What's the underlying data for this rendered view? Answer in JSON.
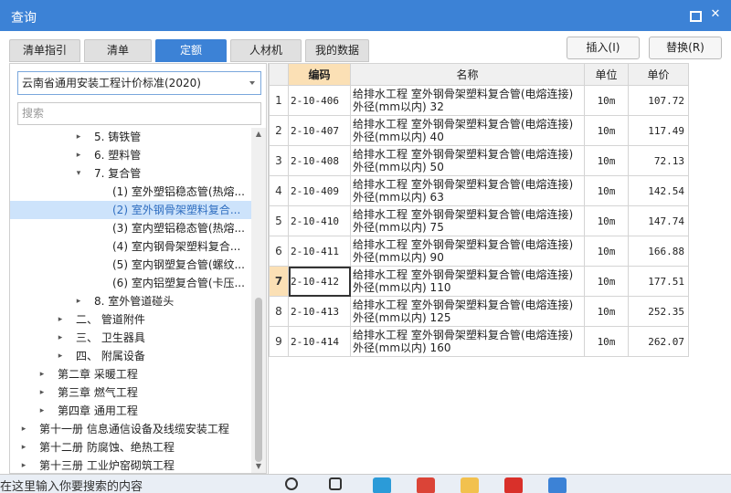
{
  "window": {
    "title": "查询"
  },
  "tabs": [
    "清单指引",
    "清单",
    "定额",
    "人材机",
    "我的数据"
  ],
  "active_tab": 2,
  "actions": {
    "insert": "插入(I)",
    "replace": "替换(R)"
  },
  "standard_select": {
    "value": "云南省通用安装工程计价标准(2020)"
  },
  "search": {
    "placeholder": "搜索"
  },
  "tree": [
    {
      "label": "5. 铸铁管",
      "arrow": "▸",
      "indent": 4
    },
    {
      "label": "6. 塑料管",
      "arrow": "▸",
      "indent": 4
    },
    {
      "label": "7. 复合管",
      "arrow": "▾",
      "indent": 4
    },
    {
      "label": "(1) 室外塑铝稳态管(热熔...",
      "arrow": "",
      "indent": 5
    },
    {
      "label": "(2) 室外钢骨架塑料复合...",
      "arrow": "",
      "indent": 5,
      "selected": true
    },
    {
      "label": "(3) 室内塑铝稳态管(热熔...",
      "arrow": "",
      "indent": 5
    },
    {
      "label": "(4) 室内钢骨架塑料复合...",
      "arrow": "",
      "indent": 5
    },
    {
      "label": "(5) 室内钢塑复合管(螺纹...",
      "arrow": "",
      "indent": 5
    },
    {
      "label": "(6) 室内铝塑复合管(卡压...",
      "arrow": "",
      "indent": 5
    },
    {
      "label": "8. 室外管道碰头",
      "arrow": "▸",
      "indent": 4
    },
    {
      "label": "二、 管道附件",
      "arrow": "▸",
      "indent": 3
    },
    {
      "label": "三、 卫生器具",
      "arrow": "▸",
      "indent": 3
    },
    {
      "label": "四、 附属设备",
      "arrow": "▸",
      "indent": 3
    },
    {
      "label": "第二章 采暖工程",
      "arrow": "▸",
      "indent": 2
    },
    {
      "label": "第三章 燃气工程",
      "arrow": "▸",
      "indent": 2
    },
    {
      "label": "第四章 通用工程",
      "arrow": "▸",
      "indent": 2
    },
    {
      "label": "第十一册 信息通信设备及线缆安装工程",
      "arrow": "▸",
      "indent": 1
    },
    {
      "label": "第十二册 防腐蚀、绝热工程",
      "arrow": "▸",
      "indent": 1
    },
    {
      "label": "第十三册 工业炉窑砌筑工程",
      "arrow": "▸",
      "indent": 1
    }
  ],
  "grid": {
    "headers": {
      "code": "编码",
      "name": "名称",
      "unit": "单位",
      "price": "单价"
    },
    "current_row": 7,
    "rows": [
      {
        "num": "1",
        "code": "2-10-406",
        "name": "给排水工程 室外钢骨架塑料复合管(电熔连接)\n外径(mm以内) 32",
        "unit": "10m",
        "price": "107.72"
      },
      {
        "num": "2",
        "code": "2-10-407",
        "name": "给排水工程 室外钢骨架塑料复合管(电熔连接)\n外径(mm以内) 40",
        "unit": "10m",
        "price": "117.49"
      },
      {
        "num": "3",
        "code": "2-10-408",
        "name": "给排水工程 室外钢骨架塑料复合管(电熔连接)\n外径(mm以内) 50",
        "unit": "10m",
        "price": "72.13"
      },
      {
        "num": "4",
        "code": "2-10-409",
        "name": "给排水工程 室外钢骨架塑料复合管(电熔连接)\n外径(mm以内) 63",
        "unit": "10m",
        "price": "142.54"
      },
      {
        "num": "5",
        "code": "2-10-410",
        "name": "给排水工程 室外钢骨架塑料复合管(电熔连接)\n外径(mm以内) 75",
        "unit": "10m",
        "price": "147.74"
      },
      {
        "num": "6",
        "code": "2-10-411",
        "name": "给排水工程 室外钢骨架塑料复合管(电熔连接)\n外径(mm以内) 90",
        "unit": "10m",
        "price": "166.88"
      },
      {
        "num": "7",
        "code": "2-10-412",
        "name": "给排水工程 室外钢骨架塑料复合管(电熔连接)\n外径(mm以内) 110",
        "unit": "10m",
        "price": "177.51"
      },
      {
        "num": "8",
        "code": "2-10-413",
        "name": "给排水工程 室外钢骨架塑料复合管(电熔连接)\n外径(mm以内) 125",
        "unit": "10m",
        "price": "252.35"
      },
      {
        "num": "9",
        "code": "2-10-414",
        "name": "给排水工程 室外钢骨架塑料复合管(电熔连接)\n外径(mm以内) 160",
        "unit": "10m",
        "price": "262.07"
      }
    ]
  },
  "taskbar": {
    "search_hint": "在这里输入你要搜索的内容",
    "icons": [
      {
        "name": "search",
        "color": "#333333"
      },
      {
        "name": "task-view",
        "color": "#333333"
      },
      {
        "name": "edge",
        "color": "#2b9bd8"
      },
      {
        "name": "chrome",
        "color": "#db4437"
      },
      {
        "name": "folder",
        "color": "#f2c14e"
      },
      {
        "name": "app-red",
        "color": "#d9302a"
      },
      {
        "name": "app-blue",
        "color": "#3c82d6"
      }
    ]
  }
}
